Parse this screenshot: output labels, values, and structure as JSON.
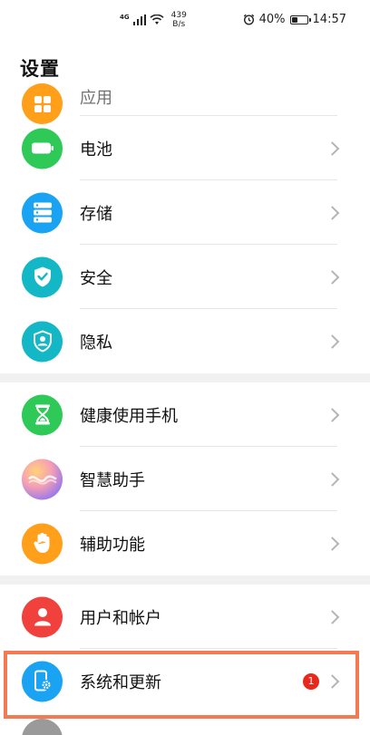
{
  "status_bar": {
    "network": "4G",
    "speed_value": "439",
    "speed_unit": "B/s",
    "battery_percent": "40%",
    "battery_level": 0.4,
    "time": "14:57"
  },
  "page_title": "设置",
  "colors": {
    "apps": "#ff9f1a",
    "battery": "#2ec957",
    "storage": "#1aa3f3",
    "security": "#13b7c6",
    "privacy": "#13b7c6",
    "health": "#2ec957",
    "accessibility": "#ff9f1a",
    "users": "#f0413d",
    "system": "#1aa3f3",
    "badge": "#e8271d",
    "highlight": "#f47a52"
  },
  "items": {
    "apps": {
      "label": "应用",
      "icon": "apps-icon"
    },
    "battery": {
      "label": "电池",
      "icon": "battery-icon"
    },
    "storage": {
      "label": "存储",
      "icon": "storage-icon"
    },
    "security": {
      "label": "安全",
      "icon": "shield-check-icon"
    },
    "privacy": {
      "label": "隐私",
      "icon": "privacy-shield-icon"
    },
    "health": {
      "label": "健康使用手机",
      "icon": "hourglass-icon"
    },
    "assistant": {
      "label": "智慧助手",
      "icon": "smart-assistant-icon"
    },
    "accessibility": {
      "label": "辅助功能",
      "icon": "hand-icon"
    },
    "users": {
      "label": "用户和帐户",
      "icon": "user-icon"
    },
    "system": {
      "label": "系统和更新",
      "icon": "phone-gear-icon",
      "badge": "1"
    }
  }
}
